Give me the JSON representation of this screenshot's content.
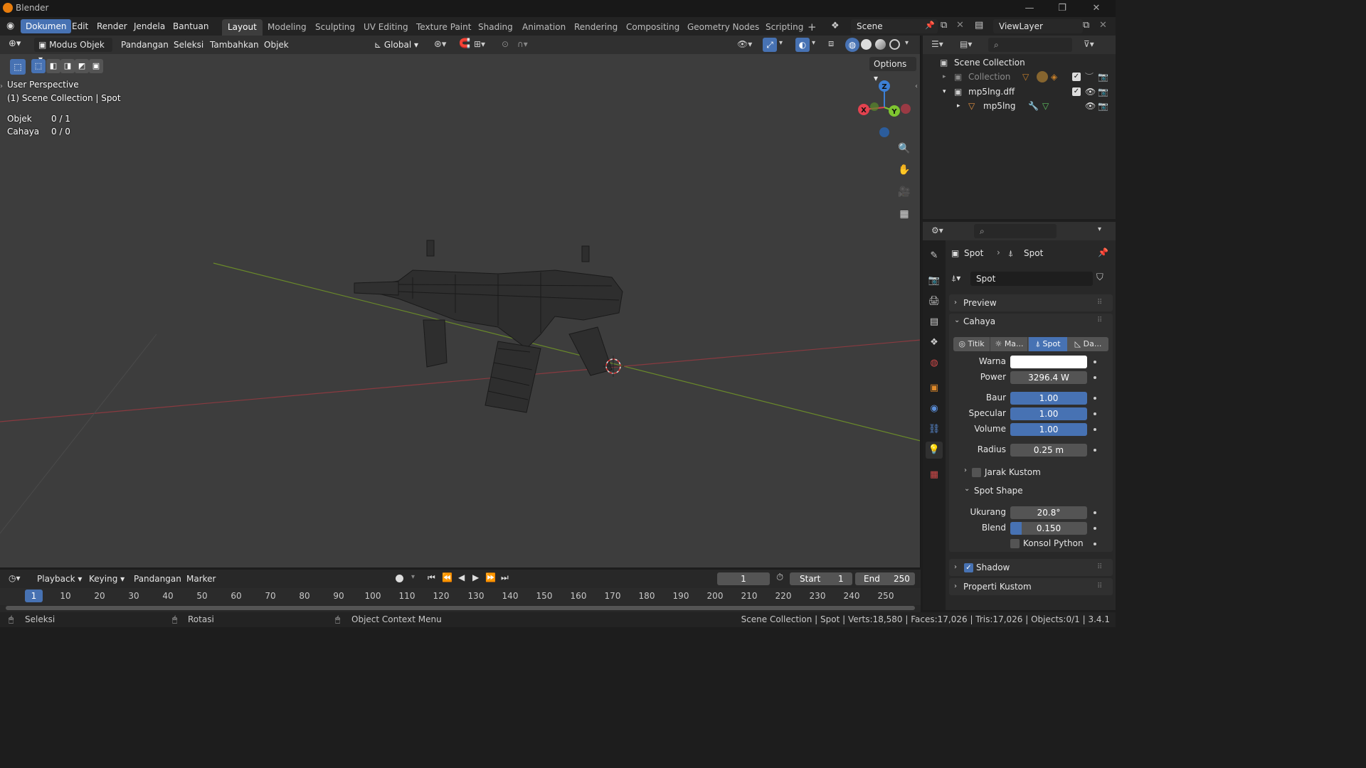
{
  "window": {
    "title": "Blender"
  },
  "menu": {
    "items": [
      "Dokumen",
      "Edit",
      "Render",
      "Jendela",
      "Bantuan"
    ]
  },
  "workspaces": [
    "Layout",
    "Modeling",
    "Sculpting",
    "UV Editing",
    "Texture Paint",
    "Shading",
    "Animation",
    "Rendering",
    "Compositing",
    "Geometry Nodes",
    "Scripting"
  ],
  "scene": {
    "name": "Scene",
    "view_layer": "ViewLayer"
  },
  "viewport": {
    "mode": "Modus Objek",
    "menus": [
      "Pandangan",
      "Seleksi",
      "Tambahkan",
      "Objek"
    ],
    "orientation": "Global",
    "options_label": "Options",
    "perspective": "User Perspective",
    "collection_info": "(1) Scene Collection | Spot",
    "stats": [
      {
        "label": "Objek",
        "value": "0 / 1"
      },
      {
        "label": "Cahaya",
        "value": "0 / 0"
      }
    ],
    "gizmo": {
      "x": "X",
      "y": "Y",
      "z": "Z"
    }
  },
  "outliner": {
    "rows": [
      {
        "label": "Scene Collection"
      },
      {
        "label": "Collection"
      },
      {
        "label": "mp5lng.dff"
      },
      {
        "label": "mp5lng"
      }
    ]
  },
  "properties": {
    "breadcrumb_object": "Spot",
    "breadcrumb_data": "Spot",
    "datablock_name": "Spot",
    "panels": {
      "preview": "Preview",
      "cahaya": "Cahaya",
      "shadow": "Shadow",
      "properti_kustom": "Properti Kustom"
    },
    "light_types": [
      "Titik",
      "Ma...",
      "Spot",
      "Da..."
    ],
    "fields": {
      "warna_label": "Warna",
      "power_label": "Power",
      "power_value": "3296.4 W",
      "baur_label": "Baur",
      "baur_value": "1.00",
      "specular_label": "Specular",
      "specular_value": "1.00",
      "volume_label": "Volume",
      "volume_value": "1.00",
      "radius_label": "Radius",
      "radius_value": "0.25 m",
      "jarak_kustom": "Jarak Kustom",
      "spot_shape": "Spot Shape",
      "ukurang_label": "Ukurang",
      "ukurang_value": "20.8°",
      "blend_label": "Blend",
      "blend_value": "0.150",
      "blend_fraction": 0.15,
      "konsol_python": "Konsol Python"
    },
    "shadow_enabled": true
  },
  "timeline": {
    "menus": [
      "Playback",
      "Keying",
      "Pandangan",
      "Marker"
    ],
    "current_frame": "1",
    "start_label": "Start",
    "start_value": "1",
    "end_label": "End",
    "end_value": "250",
    "ruler": [
      "1",
      "10",
      "20",
      "30",
      "40",
      "50",
      "60",
      "70",
      "80",
      "90",
      "100",
      "110",
      "120",
      "130",
      "140",
      "150",
      "160",
      "170",
      "180",
      "190",
      "200",
      "210",
      "220",
      "230",
      "240",
      "250"
    ]
  },
  "statusbar": {
    "select": "Seleksi",
    "rotate": "Rotasi",
    "context_menu": "Object Context Menu",
    "stats": "Scene Collection | Spot | Verts:18,580 | Faces:17,026 | Tris:17,026 | Objects:0/1 | 3.4.1"
  },
  "colors": {
    "accent": "#4772b3",
    "x_axis": "#e3424f",
    "y_axis": "#7ec530",
    "z_axis": "#3c7fd6"
  }
}
